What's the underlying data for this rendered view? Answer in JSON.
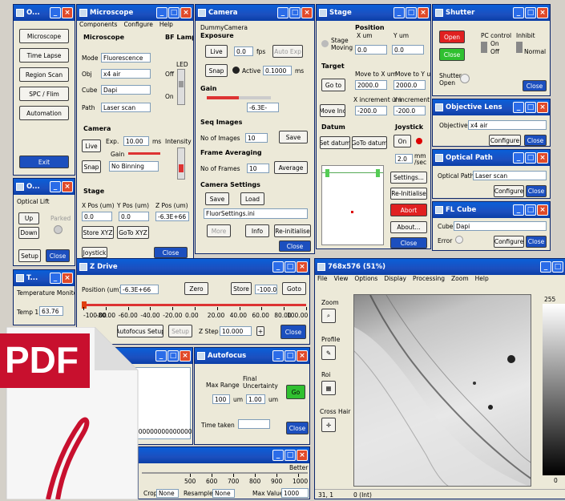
{
  "main": {
    "title": "O...",
    "buttons": [
      "Microscope",
      "Time Lapse",
      "Region Scan",
      "SPC / Flim",
      "Automation"
    ],
    "exit": "Exit"
  },
  "microscope": {
    "title": "Microscope",
    "menu": [
      "Components",
      "Configure",
      "Help"
    ],
    "section_microscope": "Microscope",
    "mode_label": "Mode",
    "mode": "Fluorescence",
    "obj_label": "Obj",
    "obj": "x4 air",
    "cube_label": "Cube",
    "cube": "Dapi",
    "path_label": "Path",
    "path": "Laser scan",
    "bf_lamp": "BF Lamp",
    "led": "LED",
    "off": "Off",
    "on": "On",
    "section_camera": "Camera",
    "live": "Live",
    "snap": "Snap",
    "exp_label": "Exp.",
    "exp": "10.00",
    "exp_unit": "ms",
    "gain_label": "Gain",
    "binning": "No Binning",
    "intensity": "Intensity",
    "section_stage": "Stage",
    "xpos_label": "X Pos (um)",
    "ypos_label": "Y Pos (um)",
    "zpos_label": "Z Pos (um)",
    "xpos": "0.0",
    "ypos": "0.0",
    "zpos": "-6.3E+66",
    "store": "Store XYZ",
    "goto": "GoTo XYZ",
    "joystick": "Joystick",
    "close": "Close"
  },
  "camera": {
    "title": "Camera",
    "device": "DummyCamera",
    "exposure": "Exposure",
    "live": "Live",
    "snap": "Snap",
    "exp": "0.0",
    "fps": "fps",
    "auto": "Auto Exp",
    "active_label": "Active",
    "active": "0.1000",
    "ms": "ms",
    "gain": "Gain",
    "gain_val": "-6.3E-",
    "seq": "Seq Images",
    "no_images_label": "No of Images",
    "no_images": "10",
    "save": "Save",
    "frame_avg": "Frame Averaging",
    "no_frames_label": "No of Frames",
    "no_frames": "10",
    "average": "Average",
    "settings": "Camera Settings",
    "save2": "Save",
    "load": "Load",
    "file": "FluorSettings.ini",
    "more": "More",
    "info": "Info",
    "reinit": "Re-initialise",
    "close": "Close"
  },
  "stage": {
    "title": "Stage",
    "position": "Position",
    "x_um": "X um",
    "y_um": "Y um",
    "stage_moving": "Stage Moving",
    "x": "0.0",
    "y": "0.0",
    "target": "Target",
    "move_x": "Move to X um",
    "move_y": "Move to Y um",
    "goto": "Go to",
    "tx": "2000.0",
    "ty": "2000.0",
    "inc_x": "X increment um",
    "inc_y": "Y increment um",
    "move_inc": "Move Inc",
    "ix": "-200.0",
    "iy": "-200.0",
    "datum": "Datum",
    "joystick": "Joystick",
    "set_datum": "Set datum",
    "goto_datum": "GoTo datum",
    "on": "On",
    "speed": "2.0",
    "mm": "mm",
    "sec": "/sec",
    "settings": "Settings...",
    "reinit": "Re-Initialise",
    "abort": "Abort",
    "about": "About...",
    "close": "Close"
  },
  "shutter": {
    "title": "Shutter",
    "open": "Open",
    "close_btn": "Close",
    "pc_control": "PC control",
    "on": "On",
    "off": "Off",
    "inhibit": "Inhibit",
    "normal": "Normal",
    "shutter_label": "Shutter",
    "shutter_state": "Open",
    "close": "Close"
  },
  "objective": {
    "title": "Objective Lens",
    "label": "Objective",
    "value": "x4 air",
    "configure": "Configure",
    "close": "Close"
  },
  "optical": {
    "title": "Optical Path",
    "label": "Optical Path",
    "value": "Laser scan",
    "configure": "Configure",
    "close": "Close"
  },
  "flcube": {
    "title": "FL Cube",
    "label": "Cube",
    "value": "Dapi",
    "error": "Error",
    "configure": "Configure",
    "close": "Close"
  },
  "oplift": {
    "title": "O...",
    "label": "Optical Lift",
    "up": "Up",
    "down": "Down",
    "parked": "Parked",
    "setup": "Setup",
    "close": "Close"
  },
  "zdrive": {
    "title": "Z Drive",
    "pos_label": "Position (um)",
    "pos": "-6.3E+66",
    "zero": "Zero",
    "store": "Store",
    "store_val": "-100.00",
    "goto": "Goto",
    "ticks": [
      "-100.00",
      "-80.00",
      "-60.00",
      "-40.00",
      "-20.00",
      "0.00",
      "20.00",
      "40.00",
      "60.00",
      "80.00",
      "100.00"
    ],
    "autofocus_setup": "Autofocus Setup",
    "setup": "Setup",
    "zstep_label": "Z Step",
    "zstep": "10.000",
    "close": "Close"
  },
  "temp": {
    "title": "T...",
    "label": "Temperature Monitor",
    "temp_label": "Temp 1",
    "temp": "63.76"
  },
  "autofocus": {
    "title": "Autofocus",
    "max_range": "Max Range",
    "final_unc": "Final Uncertainty",
    "max": "100",
    "um": "um",
    "unc": "1.00",
    "go": "Go",
    "time_taken": "Time taken",
    "close": "Close"
  },
  "image": {
    "title": "768x576 (51%)",
    "menu": [
      "File",
      "View",
      "Options",
      "Display",
      "Processing",
      "Zoom",
      "Help"
    ],
    "zoom": "Zoom",
    "profile": "Profile",
    "roi": "Roi",
    "crosshair": "Cross Hair",
    "max": "255",
    "min": "0",
    "coords": "31, 1",
    "value": "0 (Int)"
  },
  "hidden": {
    "zeros": "0000000000000000"
  },
  "bottom": {
    "better": "Better",
    "ticks": [
      "500",
      "600",
      "700",
      "800",
      "900",
      "1000"
    ],
    "crop": "Crop",
    "crop_val": "None",
    "resample": "Resample",
    "resample_val": "None",
    "maxval_label": "Max Value",
    "maxval": "1000"
  },
  "pdf": {
    "label": "PDF"
  }
}
